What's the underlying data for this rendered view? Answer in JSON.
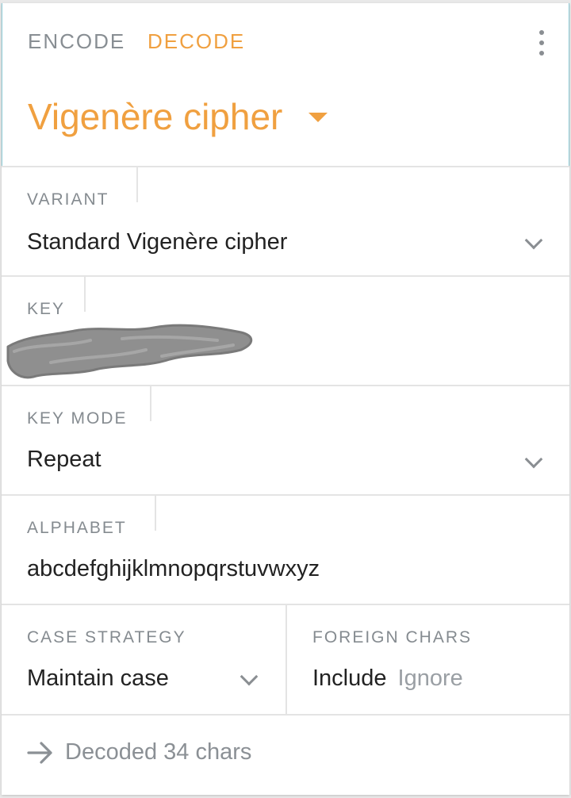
{
  "tabs": {
    "encode": "ENCODE",
    "decode": "DECODE",
    "active": "decode",
    "active_color": "#f0a040",
    "inactive_color": "#888e93"
  },
  "header": {
    "title": "Vigenère cipher",
    "more_icon": "more-vertical-icon",
    "dropdown_icon": "caret-down-icon"
  },
  "variant": {
    "label": "VARIANT",
    "value": "Standard Vigenère cipher",
    "icon": "chevron-down-icon"
  },
  "key": {
    "label": "KEY",
    "value_redacted": true
  },
  "key_mode": {
    "label": "KEY MODE",
    "value": "Repeat",
    "icon": "chevron-down-icon"
  },
  "alphabet": {
    "label": "ALPHABET",
    "value": "abcdefghijklmnopqrstuvwxyz"
  },
  "case_strategy": {
    "label": "CASE STRATEGY",
    "value": "Maintain case",
    "icon": "chevron-down-icon"
  },
  "foreign_chars": {
    "label": "FOREIGN CHARS",
    "options": [
      "Include",
      "Ignore"
    ],
    "selected": "Include"
  },
  "status": {
    "icon": "arrow-right-icon",
    "text": "Decoded 34 chars"
  },
  "colors": {
    "accent": "#f0a040",
    "header_border": "#8ccbd6",
    "divider": "#e4e4e4",
    "label": "#858b90",
    "text": "#222222"
  }
}
